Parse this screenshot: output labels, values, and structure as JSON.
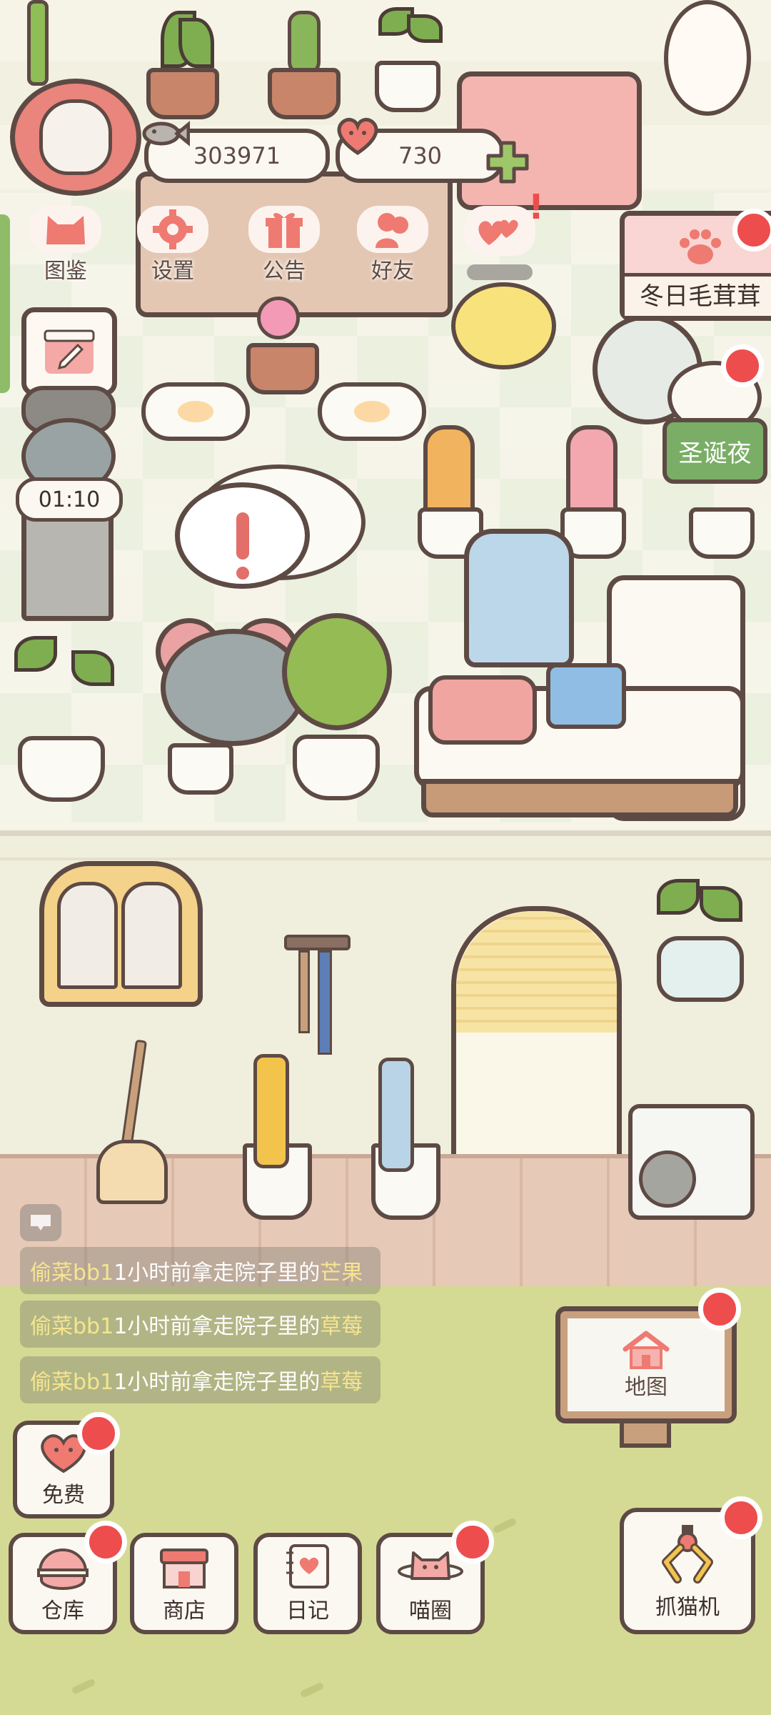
{
  "hud": {
    "fish_currency": "303971",
    "heart_currency": "730"
  },
  "top_menu": {
    "items": [
      {
        "label": "图鉴",
        "icon": "cat-head-icon"
      },
      {
        "label": "设置",
        "icon": "gear-icon"
      },
      {
        "label": "公告",
        "icon": "gift-icon"
      },
      {
        "label": "好友",
        "icon": "friends-icon"
      }
    ],
    "extra_icon": "hearts-icon"
  },
  "event": {
    "winter_label": "冬日毛茸茸",
    "christmas_label": "圣诞夜"
  },
  "timer": {
    "value": "01:10"
  },
  "activity_log": [
    {
      "user": "偷菜bb1",
      "middle": "1小时前拿走院子里的",
      "item": "芒果"
    },
    {
      "user": "偷菜bb1",
      "middle": "1小时前拿走院子里的",
      "item": "草莓"
    },
    {
      "user": "偷菜bb1",
      "middle": "1小时前拿走院子里的",
      "item": "草莓"
    }
  ],
  "map": {
    "label": "地图",
    "icon": "house-icon"
  },
  "free": {
    "label": "免费",
    "icon": "heart-icon"
  },
  "bottom_bar": {
    "items": [
      {
        "label": "仓库",
        "icon": "storage-icon"
      },
      {
        "label": "商店",
        "icon": "shop-icon"
      },
      {
        "label": "日记",
        "icon": "diary-icon"
      },
      {
        "label": "喵圈",
        "icon": "cat-planet-icon"
      }
    ],
    "claw_machine": {
      "label": "抓猫机",
      "icon": "claw-icon"
    }
  },
  "colors": {
    "accent_red": "#ee4d4d",
    "outline": "#5e4a44",
    "log_highlight": "#f6e58f",
    "grass": "#d4da94",
    "christmas_green": "#7aae66"
  }
}
